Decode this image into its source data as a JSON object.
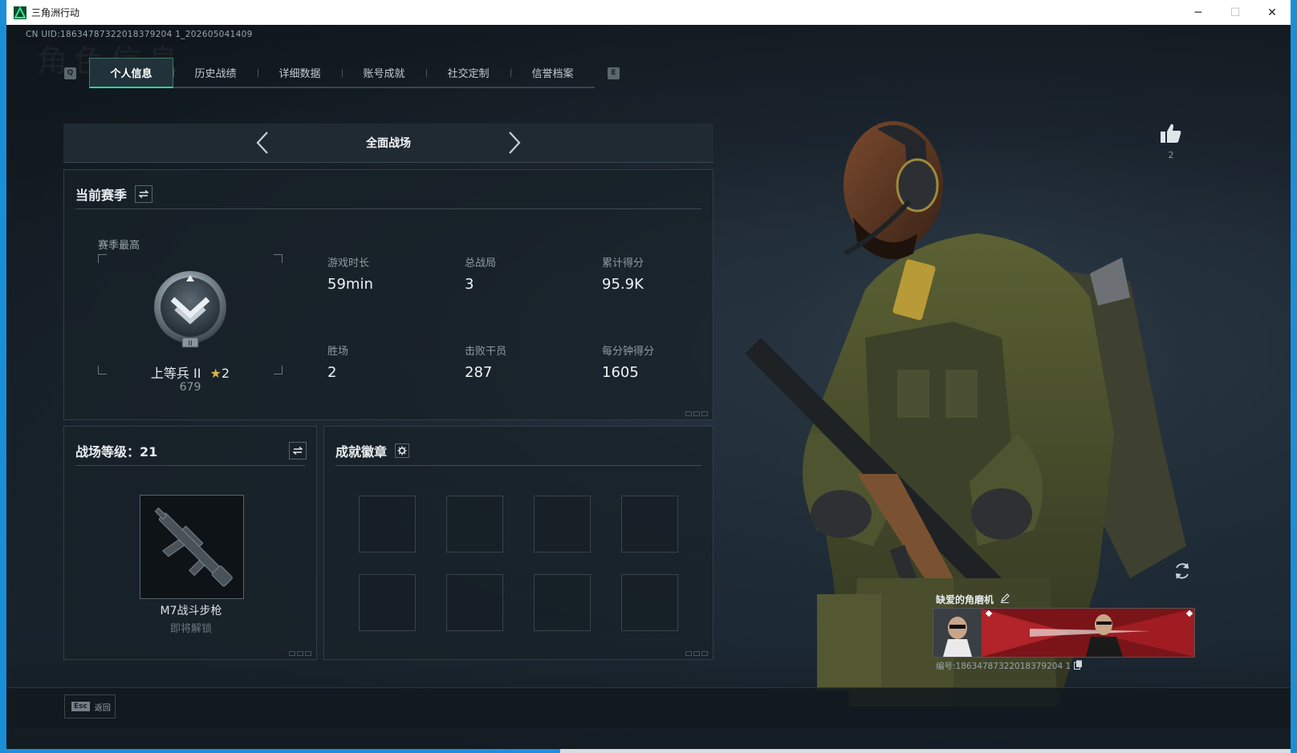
{
  "window": {
    "title": "三角洲行动",
    "minimize": "─",
    "maximize": "☐",
    "close": "✕"
  },
  "uid": "CN UID:18634787322018379204 1_202605041409",
  "watermark": "角色信息",
  "tabs": {
    "left_key": "Q",
    "right_key": "E",
    "items": [
      "个人信息",
      "历史战绩",
      "详细数据",
      "账号成就",
      "社交定制",
      "信誉档案"
    ],
    "active_index": 0
  },
  "mode": {
    "label": "全面战场"
  },
  "season": {
    "title": "当前赛季",
    "best_label": "赛季最高",
    "rank_name": "上等兵 II",
    "rank_stars": "2",
    "rank_score": "679",
    "stats": [
      {
        "label": "游戏时长",
        "value": "59min"
      },
      {
        "label": "总战局",
        "value": "3"
      },
      {
        "label": "累计得分",
        "value": "95.9K"
      },
      {
        "label": "胜场",
        "value": "2"
      },
      {
        "label": "击败干员",
        "value": "287"
      },
      {
        "label": "每分钟得分",
        "value": "1605"
      }
    ]
  },
  "level": {
    "title": "战场等级：21",
    "weapon_name": "M7战斗步枪",
    "weapon_status": "即将解锁"
  },
  "badges": {
    "title": "成就徽章",
    "slots": 8
  },
  "profile": {
    "likes": "2",
    "player_name": "缺爱的角磨机",
    "player_id": "编号:18634787322018379204 1"
  },
  "footer": {
    "esc_key": "Esc",
    "back_label": "返回"
  },
  "colors": {
    "accent": "#2fd19a",
    "panel_bg": "#182128",
    "window_border": "#1b8ed8"
  }
}
